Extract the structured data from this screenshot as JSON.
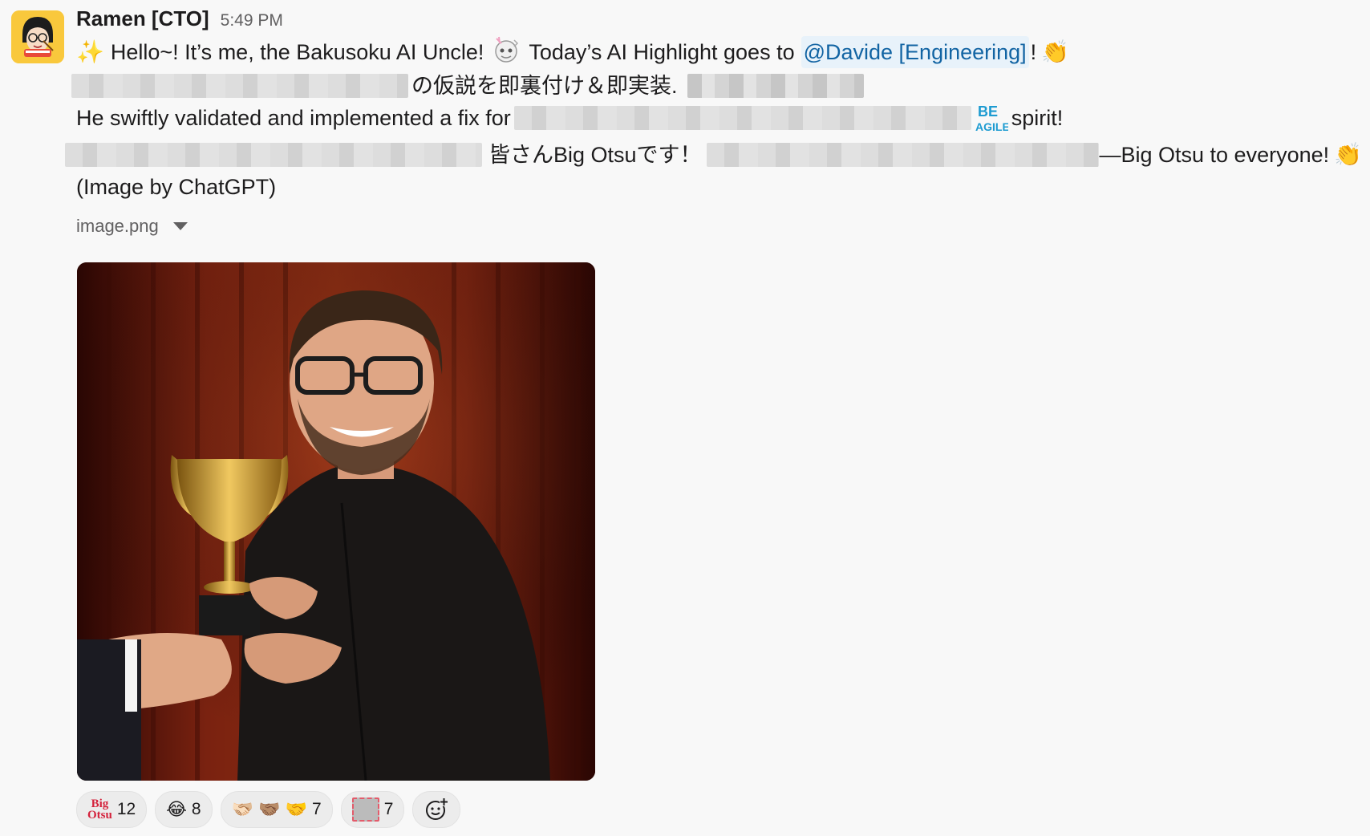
{
  "message": {
    "author": "Ramen [CTO]",
    "time": "5:49 PM",
    "line1": {
      "sparkles": "✨",
      "greeting": "Hello~! It’s me, the Bakusoku AI Uncle!",
      "highlight": "Today’s AI Highlight goes to",
      "mention": "@Davide [Engineering]",
      "bang": "!",
      "clap": "👏"
    },
    "line2": {
      "jp_text": "の仮説を即裏付け＆即実装."
    },
    "line3": {
      "text": "He swiftly validated and implemented a fix for",
      "be_agile_top": "BE",
      "be_agile_bottom": "AGILE",
      "spirit": "spirit!"
    },
    "line4": {
      "jp_text": "皆さんBig Otsuです！",
      "en_text": "—Big Otsu to everyone!",
      "clap": "👏"
    },
    "line5": "(Image by ChatGPT)"
  },
  "file": {
    "name": "image.png"
  },
  "reactions": [
    {
      "icon_top": "Big",
      "icon_bottom": "Otsu",
      "count": "12"
    },
    {
      "emoji": "😂",
      "count": "8"
    },
    {
      "emoji": "🫱🏻‍🫲🏼 🤝🏽 🤝",
      "count": "7"
    },
    {
      "emoji": "",
      "count": "7"
    }
  ],
  "colors": {
    "mention_bg": "#e8f2fa",
    "mention_text": "#1264a3",
    "be_agile": "#1d9bd1"
  },
  "icons": [
    "avatar-cartoon",
    "sparkles-icon",
    "robot-sticker-icon",
    "clap-icon",
    "be-agile-icon",
    "chevron-down-icon",
    "add-reaction-icon"
  ]
}
